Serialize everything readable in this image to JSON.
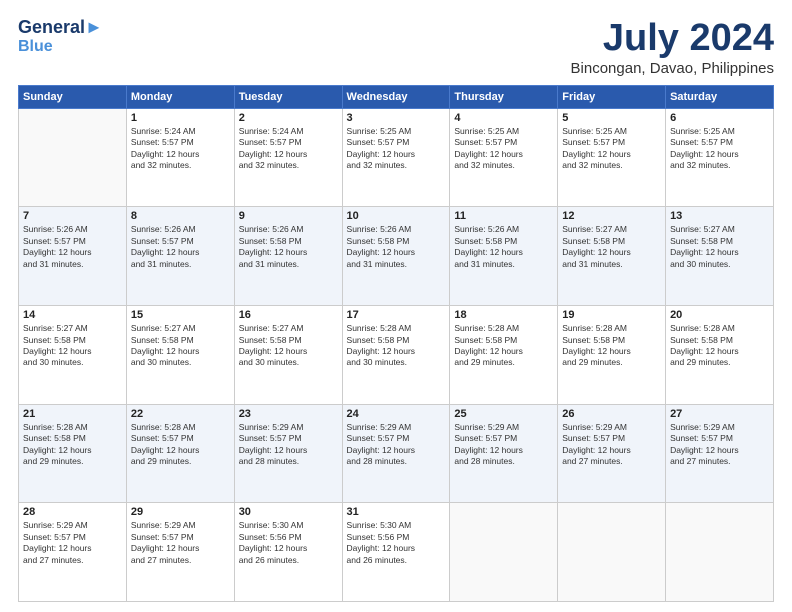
{
  "header": {
    "logo_line1": "General",
    "logo_line2": "Blue",
    "month_year": "July 2024",
    "location": "Bincongan, Davao, Philippines"
  },
  "weekdays": [
    "Sunday",
    "Monday",
    "Tuesday",
    "Wednesday",
    "Thursday",
    "Friday",
    "Saturday"
  ],
  "weeks": [
    [
      {
        "day": "",
        "info": ""
      },
      {
        "day": "1",
        "info": "Sunrise: 5:24 AM\nSunset: 5:57 PM\nDaylight: 12 hours\nand 32 minutes."
      },
      {
        "day": "2",
        "info": "Sunrise: 5:24 AM\nSunset: 5:57 PM\nDaylight: 12 hours\nand 32 minutes."
      },
      {
        "day": "3",
        "info": "Sunrise: 5:25 AM\nSunset: 5:57 PM\nDaylight: 12 hours\nand 32 minutes."
      },
      {
        "day": "4",
        "info": "Sunrise: 5:25 AM\nSunset: 5:57 PM\nDaylight: 12 hours\nand 32 minutes."
      },
      {
        "day": "5",
        "info": "Sunrise: 5:25 AM\nSunset: 5:57 PM\nDaylight: 12 hours\nand 32 minutes."
      },
      {
        "day": "6",
        "info": "Sunrise: 5:25 AM\nSunset: 5:57 PM\nDaylight: 12 hours\nand 32 minutes."
      }
    ],
    [
      {
        "day": "7",
        "info": "Sunrise: 5:26 AM\nSunset: 5:57 PM\nDaylight: 12 hours\nand 31 minutes."
      },
      {
        "day": "8",
        "info": "Sunrise: 5:26 AM\nSunset: 5:57 PM\nDaylight: 12 hours\nand 31 minutes."
      },
      {
        "day": "9",
        "info": "Sunrise: 5:26 AM\nSunset: 5:58 PM\nDaylight: 12 hours\nand 31 minutes."
      },
      {
        "day": "10",
        "info": "Sunrise: 5:26 AM\nSunset: 5:58 PM\nDaylight: 12 hours\nand 31 minutes."
      },
      {
        "day": "11",
        "info": "Sunrise: 5:26 AM\nSunset: 5:58 PM\nDaylight: 12 hours\nand 31 minutes."
      },
      {
        "day": "12",
        "info": "Sunrise: 5:27 AM\nSunset: 5:58 PM\nDaylight: 12 hours\nand 31 minutes."
      },
      {
        "day": "13",
        "info": "Sunrise: 5:27 AM\nSunset: 5:58 PM\nDaylight: 12 hours\nand 30 minutes."
      }
    ],
    [
      {
        "day": "14",
        "info": "Sunrise: 5:27 AM\nSunset: 5:58 PM\nDaylight: 12 hours\nand 30 minutes."
      },
      {
        "day": "15",
        "info": "Sunrise: 5:27 AM\nSunset: 5:58 PM\nDaylight: 12 hours\nand 30 minutes."
      },
      {
        "day": "16",
        "info": "Sunrise: 5:27 AM\nSunset: 5:58 PM\nDaylight: 12 hours\nand 30 minutes."
      },
      {
        "day": "17",
        "info": "Sunrise: 5:28 AM\nSunset: 5:58 PM\nDaylight: 12 hours\nand 30 minutes."
      },
      {
        "day": "18",
        "info": "Sunrise: 5:28 AM\nSunset: 5:58 PM\nDaylight: 12 hours\nand 29 minutes."
      },
      {
        "day": "19",
        "info": "Sunrise: 5:28 AM\nSunset: 5:58 PM\nDaylight: 12 hours\nand 29 minutes."
      },
      {
        "day": "20",
        "info": "Sunrise: 5:28 AM\nSunset: 5:58 PM\nDaylight: 12 hours\nand 29 minutes."
      }
    ],
    [
      {
        "day": "21",
        "info": "Sunrise: 5:28 AM\nSunset: 5:58 PM\nDaylight: 12 hours\nand 29 minutes."
      },
      {
        "day": "22",
        "info": "Sunrise: 5:28 AM\nSunset: 5:57 PM\nDaylight: 12 hours\nand 29 minutes."
      },
      {
        "day": "23",
        "info": "Sunrise: 5:29 AM\nSunset: 5:57 PM\nDaylight: 12 hours\nand 28 minutes."
      },
      {
        "day": "24",
        "info": "Sunrise: 5:29 AM\nSunset: 5:57 PM\nDaylight: 12 hours\nand 28 minutes."
      },
      {
        "day": "25",
        "info": "Sunrise: 5:29 AM\nSunset: 5:57 PM\nDaylight: 12 hours\nand 28 minutes."
      },
      {
        "day": "26",
        "info": "Sunrise: 5:29 AM\nSunset: 5:57 PM\nDaylight: 12 hours\nand 27 minutes."
      },
      {
        "day": "27",
        "info": "Sunrise: 5:29 AM\nSunset: 5:57 PM\nDaylight: 12 hours\nand 27 minutes."
      }
    ],
    [
      {
        "day": "28",
        "info": "Sunrise: 5:29 AM\nSunset: 5:57 PM\nDaylight: 12 hours\nand 27 minutes."
      },
      {
        "day": "29",
        "info": "Sunrise: 5:29 AM\nSunset: 5:57 PM\nDaylight: 12 hours\nand 27 minutes."
      },
      {
        "day": "30",
        "info": "Sunrise: 5:30 AM\nSunset: 5:56 PM\nDaylight: 12 hours\nand 26 minutes."
      },
      {
        "day": "31",
        "info": "Sunrise: 5:30 AM\nSunset: 5:56 PM\nDaylight: 12 hours\nand 26 minutes."
      },
      {
        "day": "",
        "info": ""
      },
      {
        "day": "",
        "info": ""
      },
      {
        "day": "",
        "info": ""
      }
    ]
  ]
}
